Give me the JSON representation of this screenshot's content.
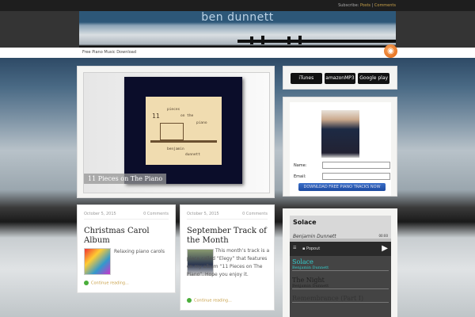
{
  "topbar": {
    "subscribe": "Subscribe:",
    "posts": "Posts",
    "separator": "|",
    "comments": "Comments"
  },
  "header": {
    "site_title": "ben  dunnett",
    "nav_item": "Free Piano Music Download"
  },
  "featured": {
    "caption": "11 Pieces on The Piano",
    "cover": {
      "number": "11",
      "line1": "pieces",
      "line2": "on the",
      "line3": "piano",
      "artist1": "benjamin",
      "artist2": "dunnett"
    }
  },
  "badges": [
    {
      "label": "iTunes"
    },
    {
      "label": "amazonMP3"
    },
    {
      "label": "Google play"
    }
  ],
  "signup": {
    "name_label": "Name:",
    "email_label": "Email:",
    "button": "DOWNLOAD FREE PIANO TRACKS NOW"
  },
  "posts": [
    {
      "date": "October 5, 2015",
      "comments": "0 Comments",
      "title": "Christmas Carol Album",
      "excerpt": "Relaxing piano carols",
      "more": "Continue reading..."
    },
    {
      "date": "October 5, 2015",
      "comments": "0 Comments",
      "title": "September Track of the Month",
      "excerpt": "This month’s track is a piece called “Elegy” that features on my album “11 Pieces on The Piano”. Hope you enjoy it.",
      "more": "Continue reading..."
    }
  ],
  "player": {
    "title": "Solace",
    "artist": "Benjamin Dunnett",
    "time": "00:00",
    "popout": "Popout",
    "tracks": [
      {
        "title": "Solace",
        "artist": "Benjamin Dunnett"
      },
      {
        "title": "The Night",
        "artist": "Benjamin Dunnett"
      },
      {
        "title": "Remembrance (Part I)",
        "artist": ""
      }
    ]
  }
}
